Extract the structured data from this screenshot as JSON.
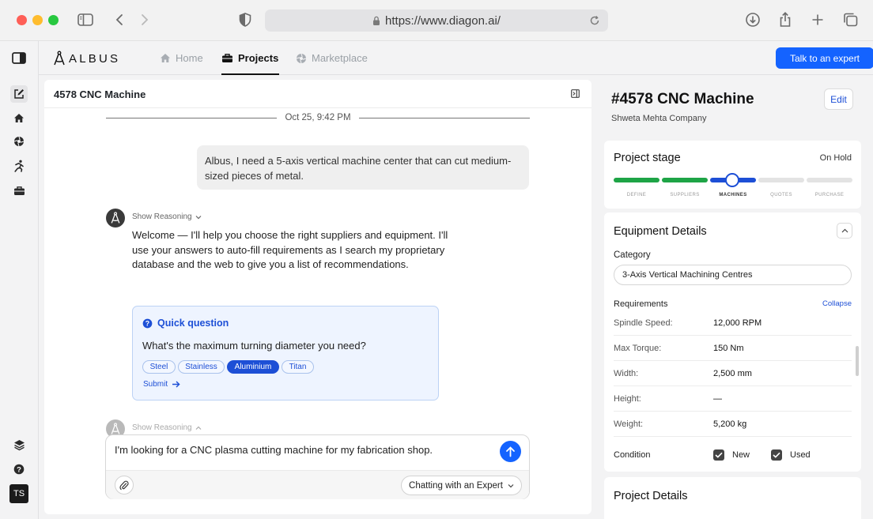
{
  "browser": {
    "url": "https://www.diagon.ai/"
  },
  "rail": {
    "avatar_initials": "TS"
  },
  "brand": {
    "logo_text": "ALBUS"
  },
  "nav": {
    "tabs": [
      {
        "label": "Home",
        "icon": "home-icon",
        "active": false
      },
      {
        "label": "Projects",
        "icon": "briefcase-icon",
        "active": true
      },
      {
        "label": "Marketplace",
        "icon": "marketplace-icon",
        "active": false
      }
    ],
    "cta_label": "Talk to an expert",
    "accent_color": "#1463ff"
  },
  "chat": {
    "title": "4578 CNC Machine",
    "date_separator": "Oct 25, 9:42 PM",
    "user_message": "Albus, I need a 5-axis vertical machine center that can cut medium-sized pieces of metal.",
    "reasoning_label": "Show Reasoning",
    "bot_message": "Welcome — I'll help you choose the right suppliers and equipment. I'll use your answers to auto-fill requirements as I search my proprietary database and the web to give you a list of recommendations.",
    "quick_question": {
      "title": "Quick question",
      "question": "What's the maximum turning diameter you need?",
      "options": [
        {
          "label": "Steel",
          "selected": false
        },
        {
          "label": "Stainless",
          "selected": false
        },
        {
          "label": "Aluminium",
          "selected": true
        },
        {
          "label": "Titan",
          "selected": false
        }
      ],
      "submit_label": "Submit"
    },
    "reasoning_label_2": "Show Reasoning",
    "composer": {
      "value": "I'm looking for a CNC plasma cutting machine for my fabrication shop.",
      "mode_label": "Chatting with an Expert"
    }
  },
  "project": {
    "title": "#4578 CNC Machine",
    "company": "Shweta Mehta Company",
    "edit_label": "Edit",
    "stage": {
      "title": "Project stage",
      "status": "On Hold",
      "steps": [
        {
          "label": "DEFINE",
          "state": "done"
        },
        {
          "label": "SUPPLIERS",
          "state": "done"
        },
        {
          "label": "MACHINES",
          "state": "current"
        },
        {
          "label": "QUOTES",
          "state": "todo"
        },
        {
          "label": "PURCHASE",
          "state": "todo"
        }
      ],
      "colors": {
        "done": "#1ea446",
        "current": "#1d4fd6",
        "todo": "#e3e3e3"
      }
    },
    "equipment": {
      "title": "Equipment Details",
      "category_label": "Category",
      "category_value": "3-Axis Vertical Machining Centres",
      "requirements_label": "Requirements",
      "collapse_label": "Collapse",
      "requirements": [
        {
          "key": "Spindle Speed:",
          "value": "12,000 RPM"
        },
        {
          "key": "Max Torque:",
          "value": "150 Nm"
        },
        {
          "key": "Width:",
          "value": "2,500 mm"
        },
        {
          "key": "Height:",
          "value": "—"
        },
        {
          "key": "Weight:",
          "value": "5,200 kg"
        }
      ],
      "condition_label": "Condition",
      "condition_options": [
        {
          "label": "New",
          "checked": true
        },
        {
          "label": "Used",
          "checked": true
        }
      ]
    },
    "project_details_title": "Project Details"
  }
}
